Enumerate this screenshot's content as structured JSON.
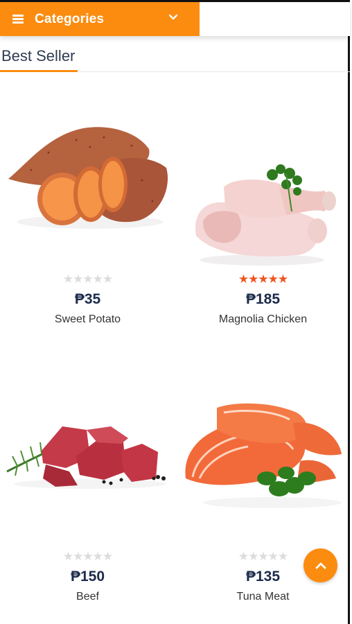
{
  "header": {
    "categories_label": "Categories"
  },
  "section": {
    "title": "Best Seller"
  },
  "products": [
    {
      "name": "Sweet Potato",
      "price": "₱35",
      "rating": 0
    },
    {
      "name": "Magnolia Chicken",
      "price": "₱185",
      "rating": 5
    },
    {
      "name": "Beef",
      "price": "₱150",
      "rating": 0
    },
    {
      "name": "Tuna Meat",
      "price": "₱135",
      "rating": 0
    }
  ],
  "icons": {
    "menu": "hamburger-icon",
    "dropdown": "chevron-down-icon",
    "scroll_top": "chevron-up-icon"
  },
  "colors": {
    "accent": "#fb8c10",
    "star_active": "#f0541e",
    "star_inactive": "#dcdcdc",
    "price": "#1b2b4b"
  }
}
